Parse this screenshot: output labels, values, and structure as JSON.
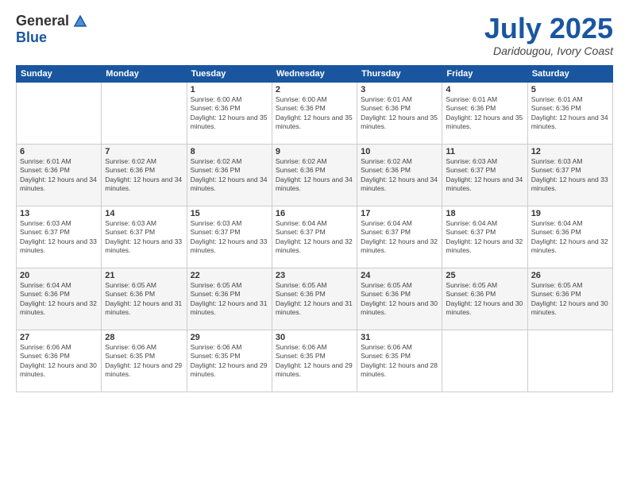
{
  "header": {
    "logo_general": "General",
    "logo_blue": "Blue",
    "month": "July 2025",
    "location": "Daridougou, Ivory Coast"
  },
  "days_of_week": [
    "Sunday",
    "Monday",
    "Tuesday",
    "Wednesday",
    "Thursday",
    "Friday",
    "Saturday"
  ],
  "weeks": [
    [
      {
        "num": "",
        "detail": ""
      },
      {
        "num": "",
        "detail": ""
      },
      {
        "num": "1",
        "detail": "Sunrise: 6:00 AM\nSunset: 6:36 PM\nDaylight: 12 hours and 35 minutes."
      },
      {
        "num": "2",
        "detail": "Sunrise: 6:00 AM\nSunset: 6:36 PM\nDaylight: 12 hours and 35 minutes."
      },
      {
        "num": "3",
        "detail": "Sunrise: 6:01 AM\nSunset: 6:36 PM\nDaylight: 12 hours and 35 minutes."
      },
      {
        "num": "4",
        "detail": "Sunrise: 6:01 AM\nSunset: 6:36 PM\nDaylight: 12 hours and 35 minutes."
      },
      {
        "num": "5",
        "detail": "Sunrise: 6:01 AM\nSunset: 6:36 PM\nDaylight: 12 hours and 34 minutes."
      }
    ],
    [
      {
        "num": "6",
        "detail": "Sunrise: 6:01 AM\nSunset: 6:36 PM\nDaylight: 12 hours and 34 minutes."
      },
      {
        "num": "7",
        "detail": "Sunrise: 6:02 AM\nSunset: 6:36 PM\nDaylight: 12 hours and 34 minutes."
      },
      {
        "num": "8",
        "detail": "Sunrise: 6:02 AM\nSunset: 6:36 PM\nDaylight: 12 hours and 34 minutes."
      },
      {
        "num": "9",
        "detail": "Sunrise: 6:02 AM\nSunset: 6:36 PM\nDaylight: 12 hours and 34 minutes."
      },
      {
        "num": "10",
        "detail": "Sunrise: 6:02 AM\nSunset: 6:36 PM\nDaylight: 12 hours and 34 minutes."
      },
      {
        "num": "11",
        "detail": "Sunrise: 6:03 AM\nSunset: 6:37 PM\nDaylight: 12 hours and 34 minutes."
      },
      {
        "num": "12",
        "detail": "Sunrise: 6:03 AM\nSunset: 6:37 PM\nDaylight: 12 hours and 33 minutes."
      }
    ],
    [
      {
        "num": "13",
        "detail": "Sunrise: 6:03 AM\nSunset: 6:37 PM\nDaylight: 12 hours and 33 minutes."
      },
      {
        "num": "14",
        "detail": "Sunrise: 6:03 AM\nSunset: 6:37 PM\nDaylight: 12 hours and 33 minutes."
      },
      {
        "num": "15",
        "detail": "Sunrise: 6:03 AM\nSunset: 6:37 PM\nDaylight: 12 hours and 33 minutes."
      },
      {
        "num": "16",
        "detail": "Sunrise: 6:04 AM\nSunset: 6:37 PM\nDaylight: 12 hours and 32 minutes."
      },
      {
        "num": "17",
        "detail": "Sunrise: 6:04 AM\nSunset: 6:37 PM\nDaylight: 12 hours and 32 minutes."
      },
      {
        "num": "18",
        "detail": "Sunrise: 6:04 AM\nSunset: 6:37 PM\nDaylight: 12 hours and 32 minutes."
      },
      {
        "num": "19",
        "detail": "Sunrise: 6:04 AM\nSunset: 6:36 PM\nDaylight: 12 hours and 32 minutes."
      }
    ],
    [
      {
        "num": "20",
        "detail": "Sunrise: 6:04 AM\nSunset: 6:36 PM\nDaylight: 12 hours and 32 minutes."
      },
      {
        "num": "21",
        "detail": "Sunrise: 6:05 AM\nSunset: 6:36 PM\nDaylight: 12 hours and 31 minutes."
      },
      {
        "num": "22",
        "detail": "Sunrise: 6:05 AM\nSunset: 6:36 PM\nDaylight: 12 hours and 31 minutes."
      },
      {
        "num": "23",
        "detail": "Sunrise: 6:05 AM\nSunset: 6:36 PM\nDaylight: 12 hours and 31 minutes."
      },
      {
        "num": "24",
        "detail": "Sunrise: 6:05 AM\nSunset: 6:36 PM\nDaylight: 12 hours and 30 minutes."
      },
      {
        "num": "25",
        "detail": "Sunrise: 6:05 AM\nSunset: 6:36 PM\nDaylight: 12 hours and 30 minutes."
      },
      {
        "num": "26",
        "detail": "Sunrise: 6:05 AM\nSunset: 6:36 PM\nDaylight: 12 hours and 30 minutes."
      }
    ],
    [
      {
        "num": "27",
        "detail": "Sunrise: 6:06 AM\nSunset: 6:36 PM\nDaylight: 12 hours and 30 minutes."
      },
      {
        "num": "28",
        "detail": "Sunrise: 6:06 AM\nSunset: 6:35 PM\nDaylight: 12 hours and 29 minutes."
      },
      {
        "num": "29",
        "detail": "Sunrise: 6:06 AM\nSunset: 6:35 PM\nDaylight: 12 hours and 29 minutes."
      },
      {
        "num": "30",
        "detail": "Sunrise: 6:06 AM\nSunset: 6:35 PM\nDaylight: 12 hours and 29 minutes."
      },
      {
        "num": "31",
        "detail": "Sunrise: 6:06 AM\nSunset: 6:35 PM\nDaylight: 12 hours and 28 minutes."
      },
      {
        "num": "",
        "detail": ""
      },
      {
        "num": "",
        "detail": ""
      }
    ]
  ]
}
